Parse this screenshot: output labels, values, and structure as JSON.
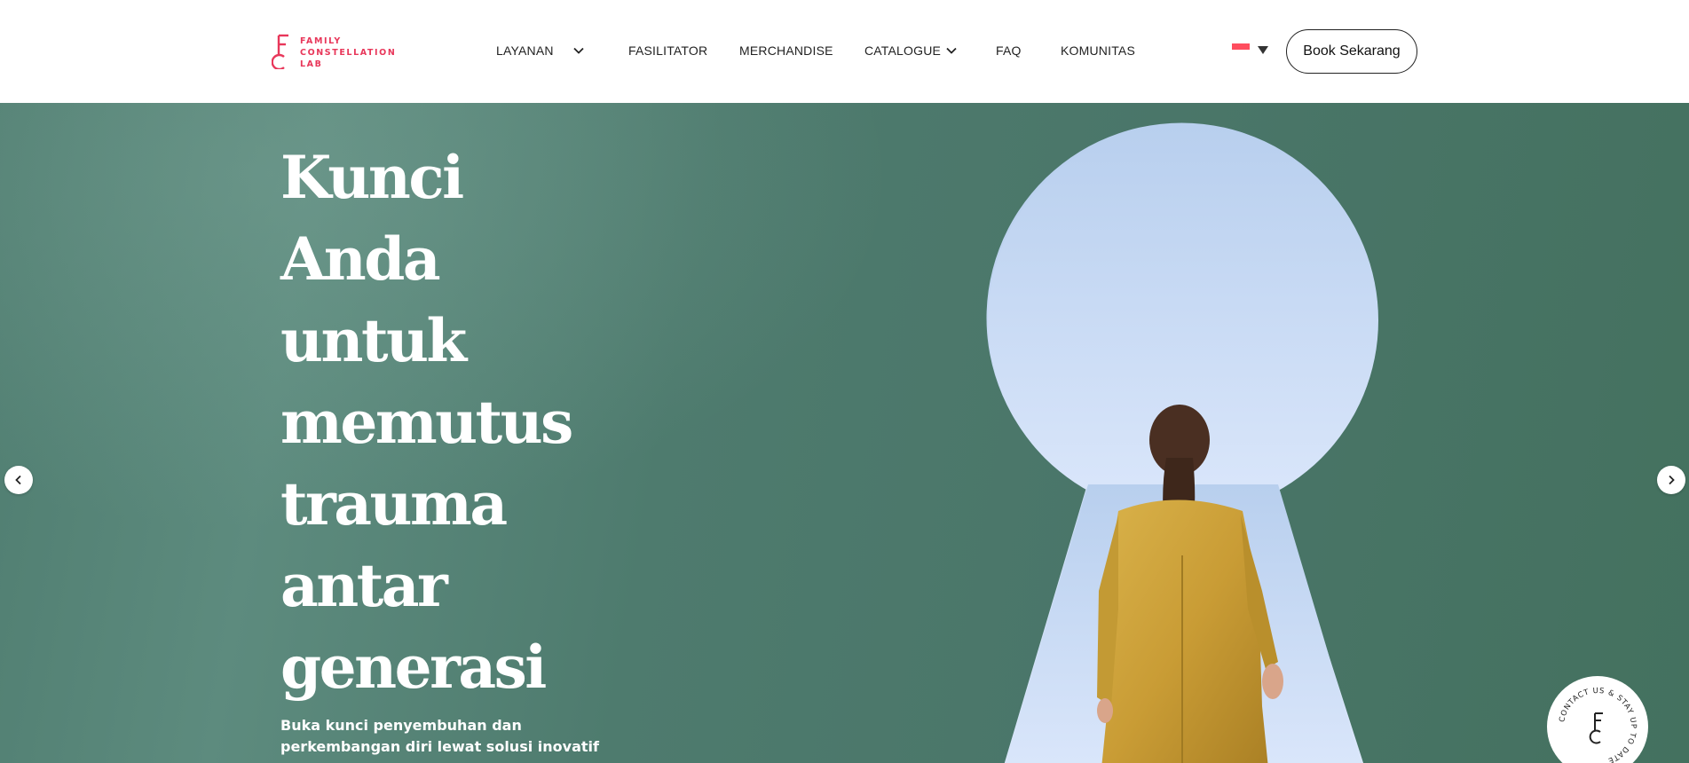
{
  "logo": {
    "line1": "FAMILY",
    "line2": "CONSTELLATION",
    "line3": "LAB",
    "color": "#e8375a",
    "icon": "key-f-logo-icon"
  },
  "nav": {
    "items": [
      {
        "label": "LAYANAN",
        "has_dropdown": true
      },
      {
        "label": "FASILITATOR",
        "has_dropdown": false
      },
      {
        "label": "MERCHANDISE",
        "has_dropdown": false
      },
      {
        "label": "CATALOGUE",
        "has_dropdown": true
      },
      {
        "label": "FAQ",
        "has_dropdown": false
      },
      {
        "label": "KOMUNITAS",
        "has_dropdown": false
      }
    ],
    "language_icon": "indonesia-flag-icon",
    "book_button": "Book Sekarang"
  },
  "hero": {
    "title_lines": [
      "Kunci",
      "Anda",
      "untuk",
      "memutus",
      "trauma",
      "antar",
      "generasi"
    ],
    "subtitle": "Buka kunci penyembuhan dan perkembangan diri lewat solusi inovatif",
    "background_color": "#4f7d70",
    "keyhole_color": "#c5daf6",
    "prev_icon": "chevron-left-icon",
    "next_icon": "chevron-right-icon"
  },
  "contact_badge": {
    "text": "CONTACT US & STAY UP TO DATE",
    "icon": "key-f-logo-icon"
  }
}
